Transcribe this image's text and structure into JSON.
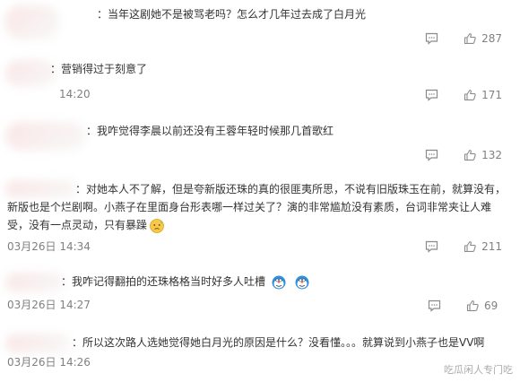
{
  "comments": [
    {
      "text": "：当年这剧她不是被骂老吗？怎么才几年过去成了白月光",
      "time": "",
      "likes": "287"
    },
    {
      "text": "：营销得过于刻意了",
      "time": "14:20",
      "likes": "171"
    },
    {
      "text": "：我咋觉得李晨以前还没有王蓉年轻时候那几首歌红",
      "time": "",
      "likes": "132"
    },
    {
      "text_line1": "：对她本人不了解，但是夸新版还珠的真的很匪夷所思，不说有旧版珠玉在前，就算没有，",
      "text_line2": "新版也是个烂剧啊。小燕子在里面身台形表哪一样过关了？演的非常尴尬没有素质，台词非常夹让人难",
      "text_line3": "受，没有一点灵动，只有暴躁",
      "time": "03月26日 14:34",
      "likes": "211"
    },
    {
      "text": "：我咋记得翻拍的还珠格格当时好多人吐槽",
      "time": "03月26日 14:27",
      "likes": "69"
    },
    {
      "text": "：所以这次路人选她觉得她白月光的原因是什么？没看懂。。。就算说到小燕子也是VV啊",
      "time": "03月26日 14:26",
      "likes": ""
    }
  ],
  "watermark": "吃瓜闲人专门吃",
  "icons": {
    "reply": "comment-icon",
    "like": "thumbs-up-icon",
    "emoji_sweat": "sweat-face-emoji",
    "emoji_doraemon": "doraemon-emoji"
  },
  "colors": {
    "text": "#333333",
    "meta": "#808080"
  }
}
